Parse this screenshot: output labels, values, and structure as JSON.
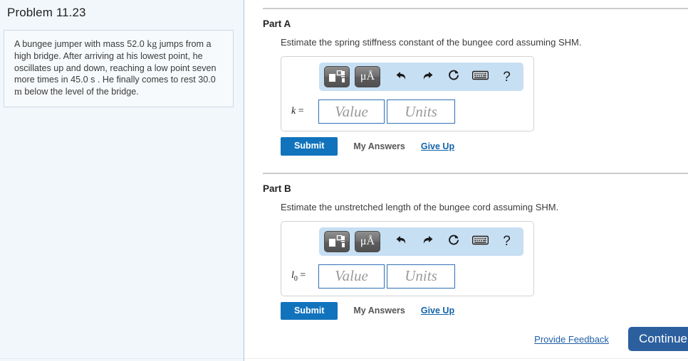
{
  "problem": {
    "title": "Problem 11.23",
    "statement_pre_mass": "A bungee jumper with mass 52.0 ",
    "mass_unit": "kg",
    "statement_mid": " jumps from a high bridge. After arriving at his lowest point, he oscillates up and down, reaching a low point seven more times in 45.0 s . He finally comes to rest 30.0 ",
    "length_unit": "m",
    "statement_end": " below the level of the bridge."
  },
  "toolbar": {
    "templates_icon": "math-templates-icon",
    "units_label": "μÅ",
    "undo_icon": "undo-arrow-icon",
    "redo_icon": "redo-arrow-icon",
    "reset_icon": "reset-circular-arrow-icon",
    "keyboard_icon": "keyboard-icon",
    "help_label": "?"
  },
  "actions": {
    "submit_label": "Submit",
    "my_answers_label": "My Answers",
    "give_up_label": "Give Up"
  },
  "fields": {
    "value_placeholder": "Value",
    "units_placeholder": "Units"
  },
  "parts": [
    {
      "label": "Part A",
      "question": "Estimate the spring stiffness constant of the bungee cord assuming SHM.",
      "symbol": "k",
      "subscript": "",
      "equals": " ="
    },
    {
      "label": "Part B",
      "question": "Estimate the unstretched length of the bungee cord assuming SHM.",
      "symbol": "l",
      "subscript": "0",
      "equals": " ="
    }
  ],
  "footer": {
    "feedback_label": "Provide Feedback",
    "continue_label": "Continue"
  },
  "colors": {
    "submit_blue": "#1273bd",
    "continue_blue": "#2c5f9e",
    "link_blue": "#1262a8",
    "toolbar_blue": "#c7dff3",
    "panel_bg": "#f2f7fb",
    "field_border": "#2f6fb5"
  }
}
